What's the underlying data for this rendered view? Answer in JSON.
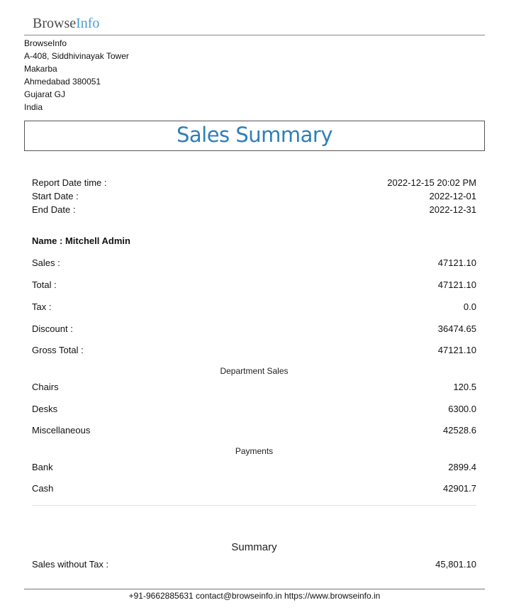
{
  "logo": {
    "part1": "Browse",
    "part2": "Info",
    "brand_color": "#4a9fd4"
  },
  "company": {
    "name": "BrowseInfo",
    "line1": "A-408, Siddhivinayak Tower",
    "line2": "Makarba",
    "line3": "Ahmedabad 380051",
    "line4": "Gujarat GJ",
    "line5": "India"
  },
  "title": "Sales Summary",
  "title_color": "#2e7fb8",
  "report": {
    "datetime_label": "Report Date time :",
    "datetime_value": "2022-12-15 20:02 PM",
    "start_label": "Start Date :",
    "start_value": "2022-12-01",
    "end_label": "End Date :",
    "end_value": "2022-12-31"
  },
  "salesperson": {
    "name_text": "Name : Mitchell Admin"
  },
  "totals": [
    {
      "label": "Sales :",
      "value": "47121.10"
    },
    {
      "label": "Total :",
      "value": "47121.10"
    },
    {
      "label": "Tax :",
      "value": "0.0"
    },
    {
      "label": "Discount :",
      "value": "36474.65"
    },
    {
      "label": "Gross Total :",
      "value": "47121.10"
    }
  ],
  "department_heading": "Department Sales",
  "departments": [
    {
      "label": "Chairs",
      "value": "120.5"
    },
    {
      "label": "Desks",
      "value": "6300.0"
    },
    {
      "label": "Miscellaneous",
      "value": "42528.6"
    }
  ],
  "payments_heading": "Payments",
  "payments": [
    {
      "label": "Bank",
      "value": "2899.4"
    },
    {
      "label": "Cash",
      "value": "42901.7"
    }
  ],
  "summary": {
    "heading": "Summary",
    "label": "Sales without Tax :",
    "value": "45,801.10"
  },
  "footer": "+91-9662885631 contact@browseinfo.in https://www.browseinfo.in"
}
